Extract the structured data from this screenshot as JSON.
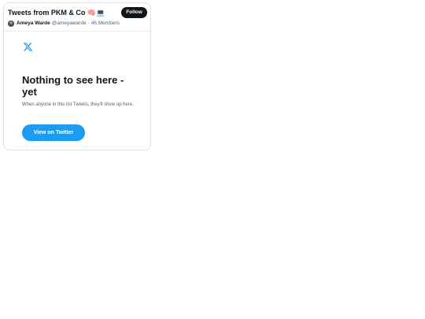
{
  "list": {
    "title": "Tweets from PKM & Co 🧠💻",
    "follow_label": "Follow",
    "owner_name": "Ameya Warde",
    "owner_handle": "@ameyawarde",
    "separator": "·",
    "members": "46 Members"
  },
  "empty_state": {
    "title": "Nothing to see here - yet",
    "subtitle": "When anyone in this list Tweets, they'll show up here.",
    "button_label": "View on Twitter"
  },
  "colors": {
    "accent": "#1d9bf0",
    "follow_bg": "#0f1419",
    "secondary_text": "#536471",
    "border": "#dbe3e8"
  },
  "icons": {
    "logo": "x-logo-icon",
    "avatar": "user-avatar"
  }
}
